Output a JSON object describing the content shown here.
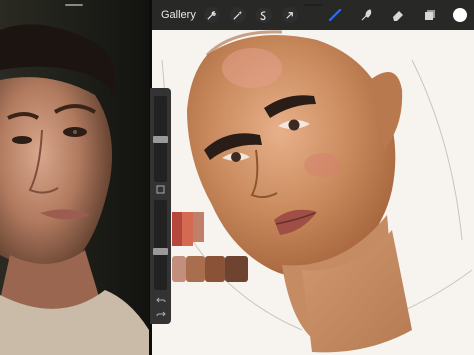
{
  "toolbar": {
    "gallery_label": "Gallery",
    "tools": [
      "wrench-icon",
      "magic-wand-icon",
      "selection-icon",
      "transform-arrow-icon"
    ],
    "right_tools": [
      "brush-icon",
      "smudge-icon",
      "eraser-icon",
      "layers-icon",
      "color-icon"
    ],
    "active_tool": "brush-icon",
    "accent_color": "#2f6df0",
    "current_color": "#ffffff"
  },
  "sidebar": {
    "buttons": [
      "modify-icon",
      "undo-icon",
      "redo-icon"
    ]
  },
  "palette": {
    "row1": [
      "#b5473d",
      "#d56a52",
      "#c07f68"
    ],
    "row2": [
      "#c28f7c",
      "#a86e4e",
      "#8a5236",
      "#6e4430",
      "#4b3229"
    ]
  }
}
